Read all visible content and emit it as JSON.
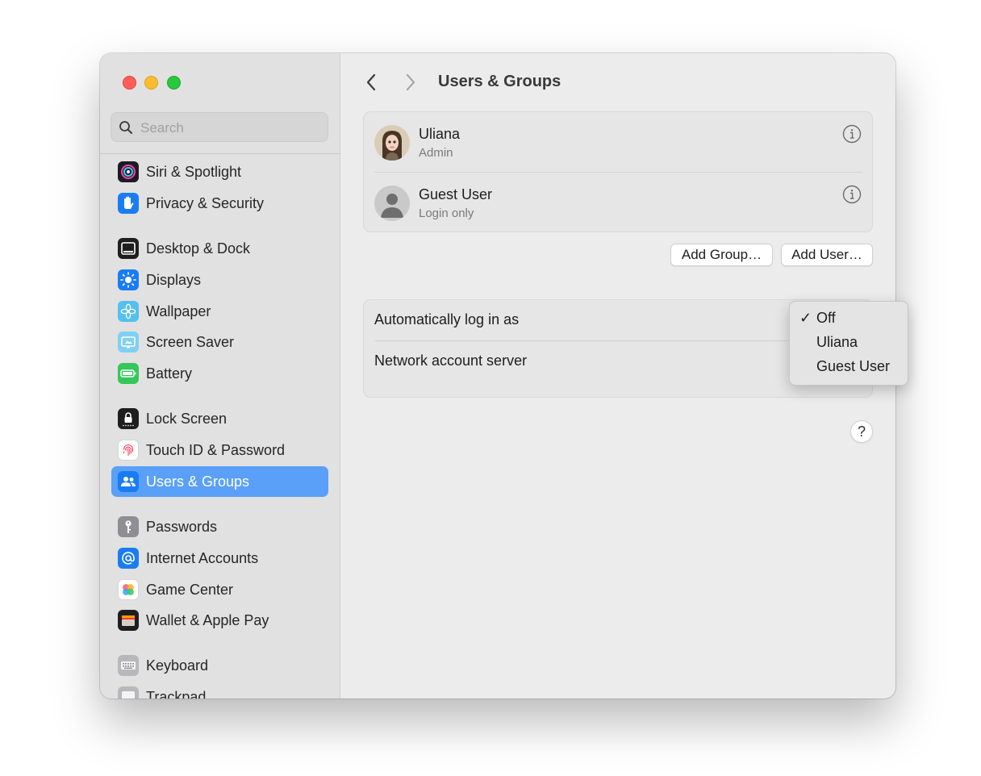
{
  "window": {
    "title": "Users & Groups"
  },
  "sidebar": {
    "search_placeholder": "Search",
    "items": [
      {
        "label": "Siri & Spotlight",
        "icon": "siri-icon"
      },
      {
        "label": "Privacy & Security",
        "icon": "hand-icon"
      },
      {
        "label": "Desktop & Dock",
        "icon": "dock-icon"
      },
      {
        "label": "Displays",
        "icon": "sun-icon"
      },
      {
        "label": "Wallpaper",
        "icon": "flower-icon"
      },
      {
        "label": "Screen Saver",
        "icon": "screensaver-icon"
      },
      {
        "label": "Battery",
        "icon": "battery-icon"
      },
      {
        "label": "Lock Screen",
        "icon": "lock-icon"
      },
      {
        "label": "Touch ID & Password",
        "icon": "fingerprint-icon"
      },
      {
        "label": "Users & Groups",
        "icon": "users-icon",
        "selected": true
      },
      {
        "label": "Passwords",
        "icon": "key-icon"
      },
      {
        "label": "Internet Accounts",
        "icon": "at-icon"
      },
      {
        "label": "Game Center",
        "icon": "game-center-icon"
      },
      {
        "label": "Wallet & Apple Pay",
        "icon": "wallet-icon"
      },
      {
        "label": "Keyboard",
        "icon": "keyboard-icon"
      },
      {
        "label": "Trackpad",
        "icon": "trackpad-icon"
      }
    ]
  },
  "users": [
    {
      "name": "Uliana",
      "role": "Admin"
    },
    {
      "name": "Guest User",
      "role": "Login only"
    }
  ],
  "buttons": {
    "add_group": "Add Group…",
    "add_user": "Add User…",
    "help": "?"
  },
  "login_options": {
    "auto_login_label": "Automatically log in as",
    "network_server_label": "Network account server"
  },
  "popup": {
    "check": "✓",
    "options": [
      {
        "label": "Off",
        "selected": true
      },
      {
        "label": "Uliana",
        "selected": false
      },
      {
        "label": "Guest User",
        "selected": false
      }
    ]
  },
  "colors": {
    "accent": "#5aa0f8",
    "sidebar_bg": "#e1e1e1",
    "content_bg": "#ececec"
  }
}
